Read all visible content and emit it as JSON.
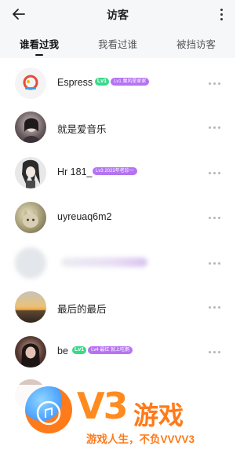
{
  "header": {
    "title": "访客"
  },
  "tabs": [
    {
      "label": "谁看过我",
      "active": true
    },
    {
      "label": "我看过谁",
      "active": false
    },
    {
      "label": "被挡访客",
      "active": false
    }
  ],
  "visitors": [
    {
      "name": "Espress",
      "vip": "Lv1",
      "level": "Lv1 魔风星家家",
      "avatar": "logo-avatar"
    },
    {
      "name": "就是爱音乐",
      "avatar": "girl-avatar"
    },
    {
      "name": "Hr 181_",
      "level": "Lv3 2023年老珍一",
      "avatar": "anime-avatar"
    },
    {
      "name": "uyreuaq6m2",
      "avatar": "cat-avatar"
    },
    {
      "name": "",
      "avatar": "blurred-avatar",
      "blurred": true
    },
    {
      "name": "最后的最后",
      "avatar": "sunset-avatar"
    },
    {
      "name": "be",
      "vip": "Lv1",
      "level": "Lv4 最红 就上吃鹅",
      "avatar": "dark-girl-avatar"
    }
  ],
  "watermark": {
    "brand": "V3",
    "word": "游戏",
    "slogan": "游戏人生，不负VVVV3"
  },
  "colors": {
    "accent": "#b573f2",
    "vip_green": "#39d98a",
    "watermark_orange": "#ff7a1a"
  }
}
